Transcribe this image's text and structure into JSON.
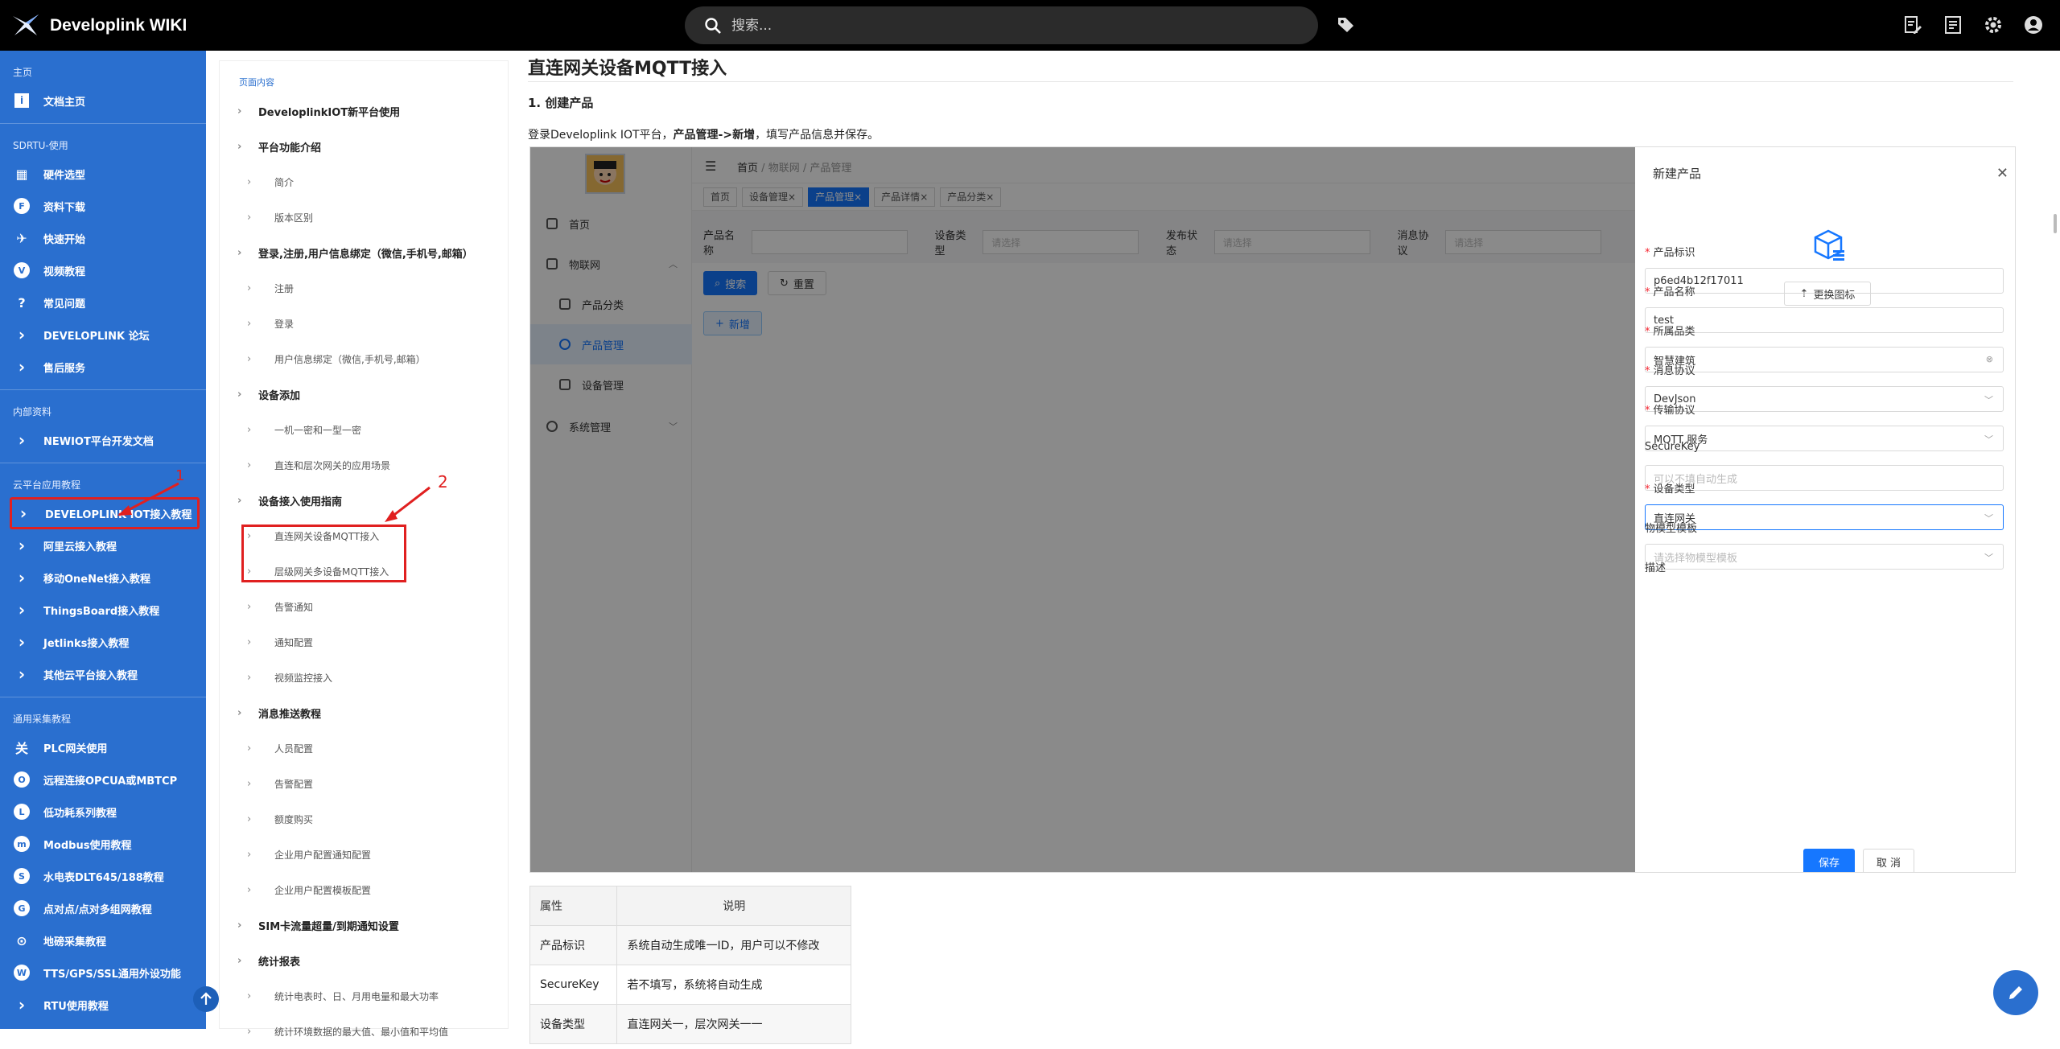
{
  "header": {
    "brand": "Developlink WIKI",
    "search_placeholder": "搜索..."
  },
  "sidebar": {
    "sections": [
      {
        "title": "主页",
        "items": [
          {
            "label": "文档主页",
            "icon": "info-icon"
          }
        ]
      },
      {
        "title": "SDRTU-使用",
        "items": [
          {
            "label": "硬件选型",
            "icon": "table-icon"
          },
          {
            "label": "资料下载",
            "icon": "f-circle-icon"
          },
          {
            "label": "快速开始",
            "icon": "plane-icon"
          },
          {
            "label": "视频教程",
            "icon": "v-circle-icon"
          },
          {
            "label": "常见问题",
            "icon": "user-question-icon"
          },
          {
            "label": "DEVELOPLINK 论坛",
            "icon": "chevron-right-icon"
          },
          {
            "label": "售后服务",
            "icon": "chevron-right-icon"
          }
        ]
      },
      {
        "title": "内部资料",
        "items": [
          {
            "label": "NEWIOT平台开发文档",
            "icon": "chevron-right-icon"
          }
        ]
      },
      {
        "title": "云平台应用教程",
        "items": [
          {
            "label": "DEVELOPLINK IOT接入教程",
            "icon": "chevron-right-icon"
          },
          {
            "label": "阿里云接入教程",
            "icon": "chevron-right-icon"
          },
          {
            "label": "移动OneNet接入教程",
            "icon": "chevron-right-icon"
          },
          {
            "label": "ThingsBoard接入教程",
            "icon": "chevron-right-icon"
          },
          {
            "label": "Jetlinks接入教程",
            "icon": "chevron-right-icon"
          },
          {
            "label": "其他云平台接入教程",
            "icon": "chevron-right-icon"
          }
        ]
      },
      {
        "title": "通用采集教程",
        "items": [
          {
            "label": "PLC网关使用",
            "icon": "plc-icon"
          },
          {
            "label": "远程连接OPCUA或MBTCP",
            "icon": "o-circle-icon"
          },
          {
            "label": "低功耗系列教程",
            "icon": "l-circle-icon"
          },
          {
            "label": "Modbus使用教程",
            "icon": "m-circle-icon"
          },
          {
            "label": "水电表DLT645/188教程",
            "icon": "s-circle-icon"
          },
          {
            "label": "点对点/点对多组网教程",
            "icon": "g-circle-icon"
          },
          {
            "label": "地磅采集教程",
            "icon": "scale-icon"
          },
          {
            "label": "TTS/GPS/SSL通用外设功能",
            "icon": "w-circle-icon"
          },
          {
            "label": "RTU使用教程",
            "icon": "chevron-right-icon"
          }
        ]
      }
    ]
  },
  "toc": {
    "heading": "页面内容",
    "items": [
      {
        "label": "DeveloplinkIOT新平台使用",
        "level": 1
      },
      {
        "label": "平台功能介绍",
        "level": 1
      },
      {
        "label": "简介",
        "level": 2
      },
      {
        "label": "版本区别",
        "level": 2
      },
      {
        "label": "登录,注册,用户信息绑定（微信,手机号,邮箱）",
        "level": 1
      },
      {
        "label": "注册",
        "level": 2
      },
      {
        "label": "登录",
        "level": 2
      },
      {
        "label": "用户信息绑定（微信,手机号,邮箱）",
        "level": 2
      },
      {
        "label": "设备添加",
        "level": 1
      },
      {
        "label": "一机一密和一型一密",
        "level": 2
      },
      {
        "label": "直连和层次网关的应用场景",
        "level": 2
      },
      {
        "label": "设备接入使用指南",
        "level": 1
      },
      {
        "label": "直连网关设备MQTT接入",
        "level": 2
      },
      {
        "label": "层级网关多设备MQTT接入",
        "level": 2
      },
      {
        "label": "告警通知",
        "level": 2
      },
      {
        "label": "通知配置",
        "level": 2
      },
      {
        "label": "视频监控接入",
        "level": 2
      },
      {
        "label": "消息推送教程",
        "level": 1
      },
      {
        "label": "人员配置",
        "level": 2
      },
      {
        "label": "告警配置",
        "level": 2
      },
      {
        "label": "额度购买",
        "level": 2
      },
      {
        "label": "企业用户配置通知配置",
        "level": 2
      },
      {
        "label": "企业用户配置模板配置",
        "level": 2
      },
      {
        "label": "SIM卡流量超量/到期通知设置",
        "level": 1
      },
      {
        "label": "统计报表",
        "level": 1
      },
      {
        "label": "统计电表时、日、月用电量和最大功率",
        "level": 2
      },
      {
        "label": "统计环境数据的最大值、最小值和平均值",
        "level": 2
      }
    ]
  },
  "annotations": {
    "one": "1",
    "two": "2"
  },
  "content": {
    "title": "直连网关设备MQTT接入",
    "step1": "1. 创建产品",
    "para_prefix": "登录Developlink IOT平台，",
    "para_bold": "产品管理->新增",
    "para_suffix": "，填写产品信息并保存。"
  },
  "shot": {
    "side_nav": [
      {
        "label": "首页"
      },
      {
        "label": "物联网"
      },
      {
        "label": "产品分类"
      },
      {
        "label": "产品管理"
      },
      {
        "label": "设备管理"
      },
      {
        "label": "系统管理"
      }
    ],
    "breadcrumb": {
      "home": "首页",
      "sep": "/",
      "iot": "物联网",
      "page": "产品管理"
    },
    "tabs": [
      "首页",
      "设备管理",
      "产品管理",
      "产品详情",
      "产品分类"
    ],
    "filters": {
      "name_label": "产品名称",
      "type_label": "设备类型",
      "type_ph": "请选择",
      "status_label": "发布状态",
      "status_ph": "请选择",
      "proto_label": "消息协议",
      "proto_ph": "请选择"
    },
    "btn_search": "搜索",
    "btn_reset": "重置",
    "btn_add": "新增",
    "drawer": {
      "title": "新建产品",
      "upload": "更换图标",
      "fields": [
        {
          "label": "产品标识",
          "required": true,
          "value": "p6ed4b12f17011",
          "placeholder": ""
        },
        {
          "label": "产品名称",
          "required": true,
          "value": "test",
          "placeholder": ""
        },
        {
          "label": "所属品类",
          "required": true,
          "value": "智慧建筑",
          "placeholder": ""
        },
        {
          "label": "消息协议",
          "required": true,
          "value": "DevJson",
          "placeholder": ""
        },
        {
          "label": "传输协议",
          "required": true,
          "value": "MQTT 服务",
          "placeholder": ""
        },
        {
          "label": "SecureKey",
          "required": false,
          "value": "",
          "placeholder": "可以不填自动生成"
        },
        {
          "label": "设备类型",
          "required": true,
          "value": "直连网关",
          "placeholder": ""
        },
        {
          "label": "物模型模板",
          "required": false,
          "value": "",
          "placeholder": "请选择物模型模板"
        },
        {
          "label": "描述",
          "required": false,
          "value": "",
          "placeholder": ""
        }
      ],
      "save": "保存",
      "cancel": "取 消"
    }
  },
  "table": {
    "headers": [
      "属性",
      "说明"
    ],
    "rows": [
      [
        "产品标识",
        "系统自动生成唯一ID，用户可以不修改"
      ],
      [
        "SecureKey",
        "若不填写，系统将自动生成"
      ],
      [
        "设备类型",
        "直连网关一，层次网关一一"
      ]
    ]
  },
  "colors": {
    "sidebar": "#2a6fcf",
    "topbar": "#000000",
    "accent": "#1677ff",
    "annotation": "#e02020"
  }
}
